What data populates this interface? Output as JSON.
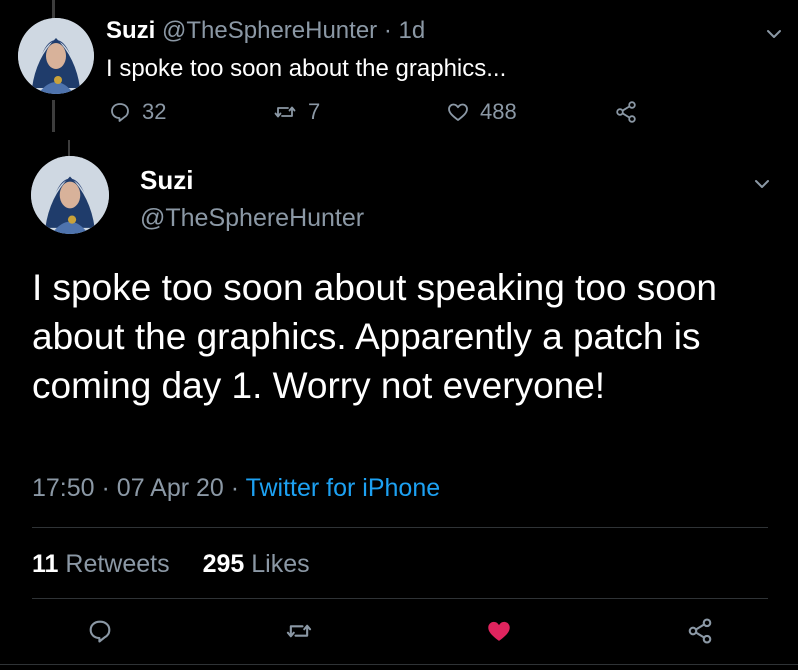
{
  "reply_tweet": {
    "name": "Suzi",
    "handle": "@TheSphereHunter",
    "separator": "·",
    "time": "1d",
    "text": "I spoke too soon about the graphics...",
    "replies": "32",
    "retweets": "7",
    "likes": "488"
  },
  "main_tweet": {
    "name": "Suzi",
    "handle": "@TheSphereHunter",
    "text": "I spoke too soon about speaking too soon about the graphics. Apparently a patch is coming day 1. Worry not everyone!",
    "time": "17:50",
    "sep1": "·",
    "date": "07 Apr 20",
    "sep2": "·",
    "source": "Twitter for iPhone",
    "retweet_count": "11",
    "retweet_label": "Retweets",
    "like_count": "295",
    "like_label": "Likes"
  },
  "colors": {
    "background": "#000000",
    "muted": "#8b98a5",
    "link": "#1da1f2",
    "like_active": "#e0245e",
    "divider": "#2f3336"
  },
  "icons": [
    "chevron-down-icon",
    "reply-icon",
    "retweet-icon",
    "heart-icon",
    "share-icon"
  ]
}
